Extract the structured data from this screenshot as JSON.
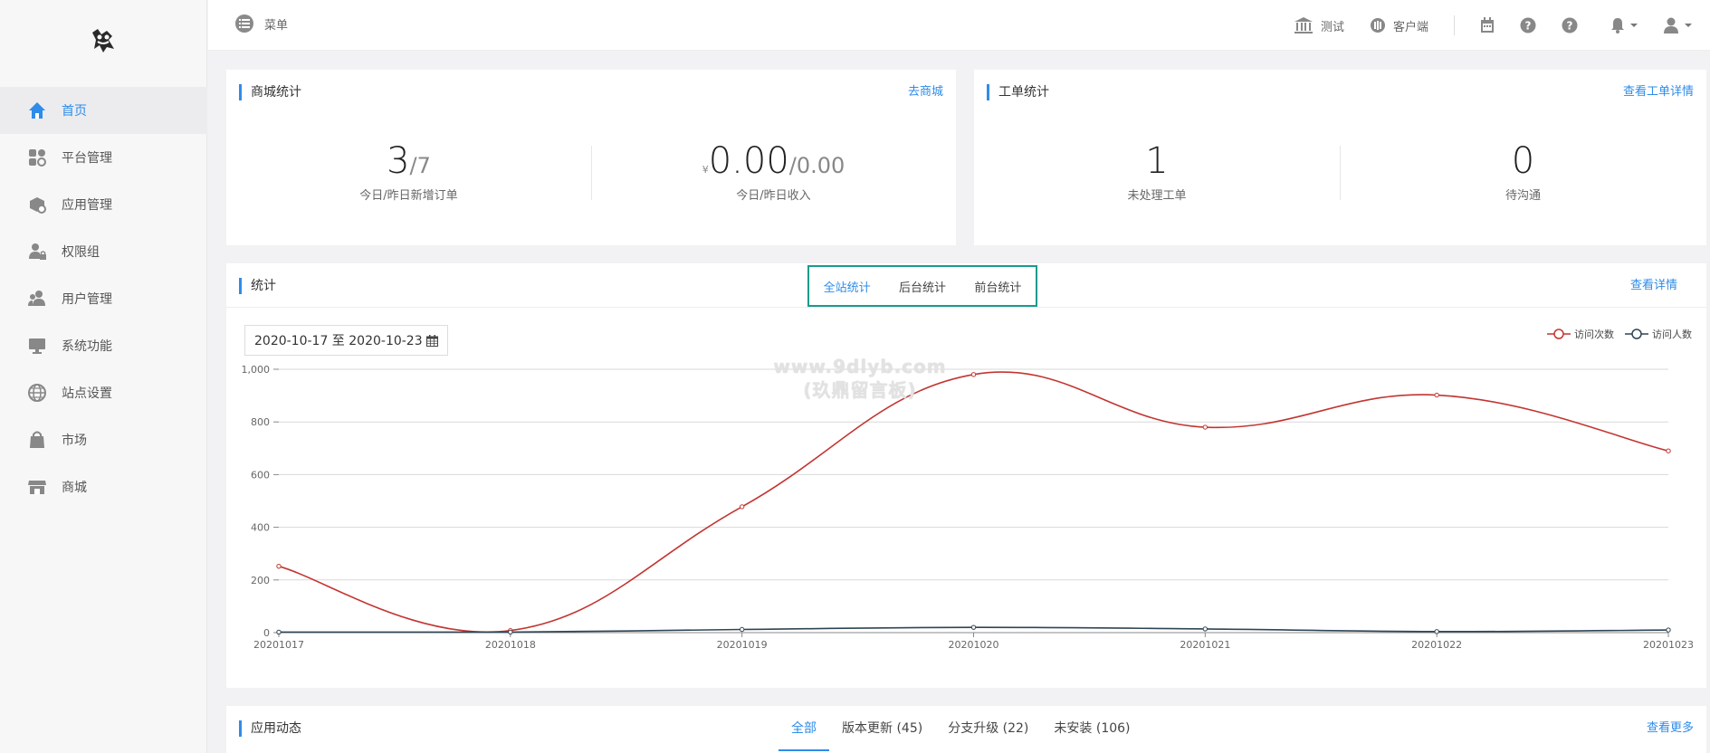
{
  "sidebar": {
    "items": [
      {
        "label": "首页",
        "icon": "home-icon"
      },
      {
        "label": "平台管理",
        "icon": "platform-icon"
      },
      {
        "label": "应用管理",
        "icon": "app-package-icon"
      },
      {
        "label": "权限组",
        "icon": "user-lock-icon"
      },
      {
        "label": "用户管理",
        "icon": "users-icon"
      },
      {
        "label": "系统功能",
        "icon": "monitor-icon"
      },
      {
        "label": "站点设置",
        "icon": "globe-icon"
      },
      {
        "label": "市场",
        "icon": "shopping-bag-icon"
      },
      {
        "label": "商城",
        "icon": "store-icon"
      }
    ]
  },
  "topbar": {
    "menu_label": "菜单",
    "test_label": "测试",
    "client_label": "客户端"
  },
  "mall": {
    "title": "商城统计",
    "link": "去商城",
    "orders_today": "3",
    "orders_yesterday": "/7",
    "orders_label": "今日/昨日新增订单",
    "currency": "¥",
    "income_today": "0.00",
    "income_yesterday": "/0.00",
    "income_label": "今日/昨日收入"
  },
  "ticket": {
    "title": "工单统计",
    "link": "查看工单详情",
    "unprocessed": "1",
    "unprocessed_label": "未处理工单",
    "pending": "0",
    "pending_label": "待沟通"
  },
  "stats": {
    "title": "统计",
    "tabs": [
      "全站统计",
      "后台统计",
      "前台统计"
    ],
    "link": "查看详情",
    "date_range": "2020-10-17 至 2020-10-23"
  },
  "activity": {
    "title": "应用动态",
    "tabs": [
      "全部",
      "版本更新 (45)",
      "分支升级 (22)",
      "未安装 (106)"
    ],
    "link": "查看更多"
  },
  "watermark": {
    "line1": "www.9dlyb.com",
    "line2": "(玖鼎留言板)"
  },
  "chart_data": {
    "type": "line",
    "categories": [
      "20201017",
      "20201018",
      "20201019",
      "20201020",
      "20201021",
      "20201022",
      "20201023"
    ],
    "series": [
      {
        "name": "访问次数",
        "color": "#c23531",
        "values": [
          252,
          8,
          478,
          980,
          780,
          902,
          690
        ]
      },
      {
        "name": "访问人数",
        "color": "#2f4554",
        "values": [
          2,
          2,
          12,
          20,
          14,
          4,
          10
        ]
      }
    ],
    "ylim": [
      0,
      1000
    ],
    "yticks": [
      0,
      200,
      400,
      600,
      800,
      1000
    ],
    "ytick_labels": [
      "0",
      "200",
      "400",
      "600",
      "800",
      "1,000"
    ],
    "grid": true,
    "legend": "top-right"
  }
}
